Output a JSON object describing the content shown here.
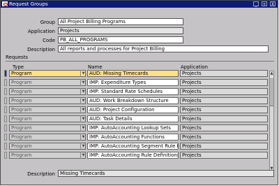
{
  "window": {
    "title": "Request Groups",
    "btn_min": "_",
    "btn_max": "+",
    "btn_close": "X"
  },
  "header": {
    "group_label": "Group",
    "group_value": "All Project Billing Programs",
    "application_label": "Application",
    "application_value": "Projects",
    "code_label": "Code",
    "code_value": "PB_ALL_PROGRAMS",
    "description_label": "Description",
    "description_value": "All reports and processes for Project Billing"
  },
  "requests": {
    "section_label": "Requests",
    "columns": {
      "type": "Type",
      "name": "Name",
      "application": "Application"
    },
    "rows": [
      {
        "type": "Program",
        "name": "AUD: Missing Timecards",
        "application": "Projects"
      },
      {
        "type": "Program",
        "name": "IMP: Expenditure Types",
        "application": "Projects"
      },
      {
        "type": "Program",
        "name": "IMP: Standard Rate Schedules",
        "application": "Projects"
      },
      {
        "type": "Program",
        "name": "AUD: Work Breakdown Structure",
        "application": "Projects"
      },
      {
        "type": "Program",
        "name": "AUD: Project Configuration",
        "application": "Projects"
      },
      {
        "type": "Program",
        "name": "AUD: Task Details",
        "application": "Projects"
      },
      {
        "type": "Program",
        "name": "IMP: AutoAccounting Lookup Sets",
        "application": "Projects"
      },
      {
        "type": "Program",
        "name": "IMP: AutoAccounting Functions",
        "application": "Projects"
      },
      {
        "type": "Program",
        "name": "IMP: AutoAccounting Segment Rule Pairin",
        "application": "Projects"
      },
      {
        "type": "Program",
        "name": "IMP: AutoAccounting Rule Definitions",
        "application": "Projects"
      }
    ]
  },
  "footer": {
    "description_label": "Description",
    "description_value": "Missing Timecards"
  },
  "colors": {
    "titlebar": "#0f1c73",
    "window_bg": "#c6c3c6",
    "selected_field": "#ffe08a",
    "current_record": "#1b2a8a"
  }
}
